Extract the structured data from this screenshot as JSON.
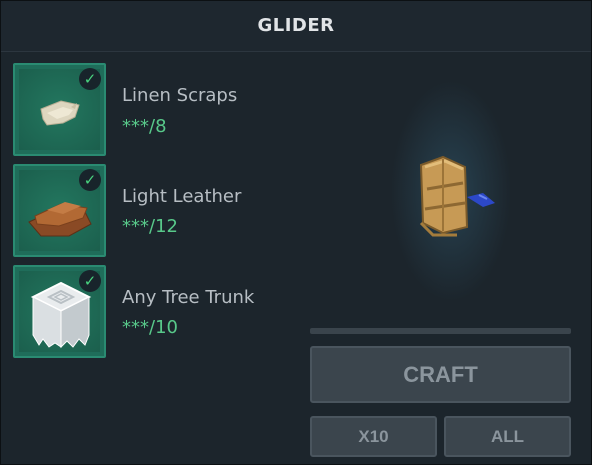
{
  "title": "GLIDER",
  "ingredients": [
    {
      "name": "Linen Scraps",
      "qty": "***/8",
      "icon": "linen-scraps-icon",
      "checked": true
    },
    {
      "name": "Light Leather",
      "qty": "***/12",
      "icon": "light-leather-icon",
      "checked": true
    },
    {
      "name": "Any Tree Trunk",
      "qty": "***/10",
      "icon": "tree-trunk-icon",
      "checked": true
    }
  ],
  "check_glyph": "✓",
  "buttons": {
    "craft": "CRAFT",
    "x10": "X10",
    "all": "ALL"
  },
  "crafting_progress": 0,
  "colors": {
    "accent_green": "#58c98a",
    "slot_green": "#1f6d5a",
    "button_bg": "#3b454d"
  }
}
